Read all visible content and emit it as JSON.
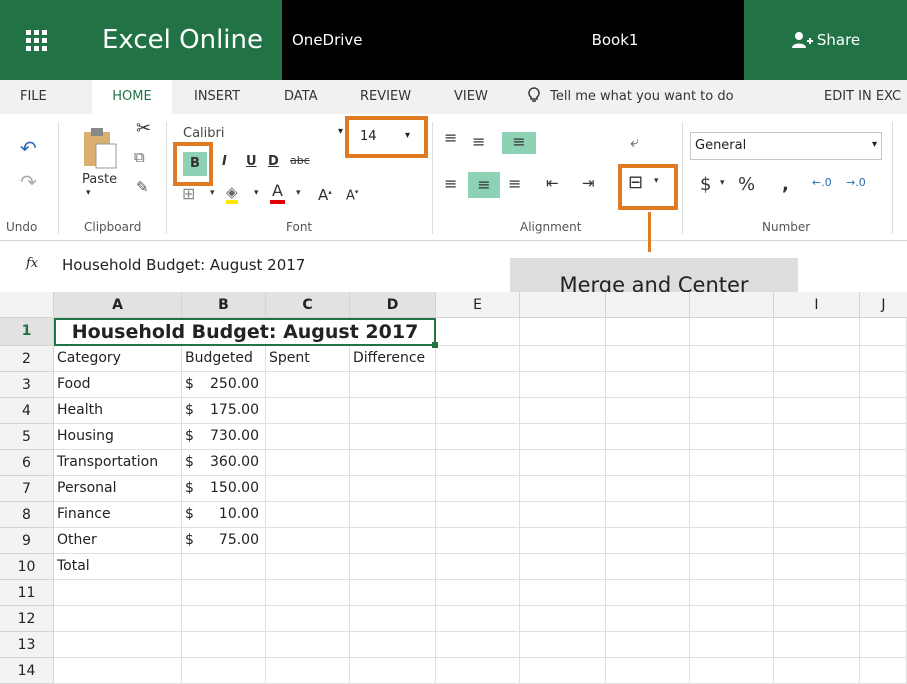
{
  "app": {
    "name": "Excel Online",
    "location": "OneDrive",
    "document": "Book1",
    "share": "Share"
  },
  "tabs": [
    "FILE",
    "HOME",
    "INSERT",
    "DATA",
    "REVIEW",
    "VIEW"
  ],
  "tell_me": "Tell me what you want to do",
  "edit_in": "EDIT IN EXC",
  "ribbon": {
    "undo_label": "Undo",
    "paste_label": "Paste",
    "clipboard_label": "Clipboard",
    "font_name": "Calibri",
    "font_size": "14",
    "bold": "B",
    "italic": "I",
    "underline": "U",
    "double_underline": "D",
    "strike": "abc",
    "font_color": "A",
    "font_label": "Font",
    "alignment_label": "Alignment",
    "number_format": "General",
    "currency": "$",
    "percent": "%",
    "comma": ",",
    "number_label": "Number"
  },
  "formula_bar": {
    "fx": "fx",
    "value": "Household Budget: August 2017"
  },
  "callout": "Merge and Center",
  "columns": [
    "A",
    "B",
    "C",
    "D",
    "E",
    "I",
    "J"
  ],
  "rows": [
    "1",
    "2",
    "3",
    "4",
    "5",
    "6",
    "7",
    "8",
    "9",
    "10",
    "11",
    "12",
    "13",
    "14"
  ],
  "sheet": {
    "title": "Household Budget: August 2017",
    "headers": [
      "Category",
      "Budgeted",
      "Spent",
      "Difference"
    ],
    "data": [
      {
        "category": "Food",
        "currency": "$",
        "amount": "250.00"
      },
      {
        "category": "Health",
        "currency": "$",
        "amount": "175.00"
      },
      {
        "category": "Housing",
        "currency": "$",
        "amount": "730.00"
      },
      {
        "category": "Transportation",
        "currency": "$",
        "amount": "360.00"
      },
      {
        "category": "Personal",
        "currency": "$",
        "amount": "150.00"
      },
      {
        "category": "Finance",
        "currency": "$",
        "amount": "10.00"
      },
      {
        "category": "Other",
        "currency": "$",
        "amount": "75.00"
      }
    ],
    "total_label": "Total"
  },
  "colors": {
    "accent": "#217346",
    "highlight": "#e07a23",
    "selected": "#8ed2b5"
  }
}
